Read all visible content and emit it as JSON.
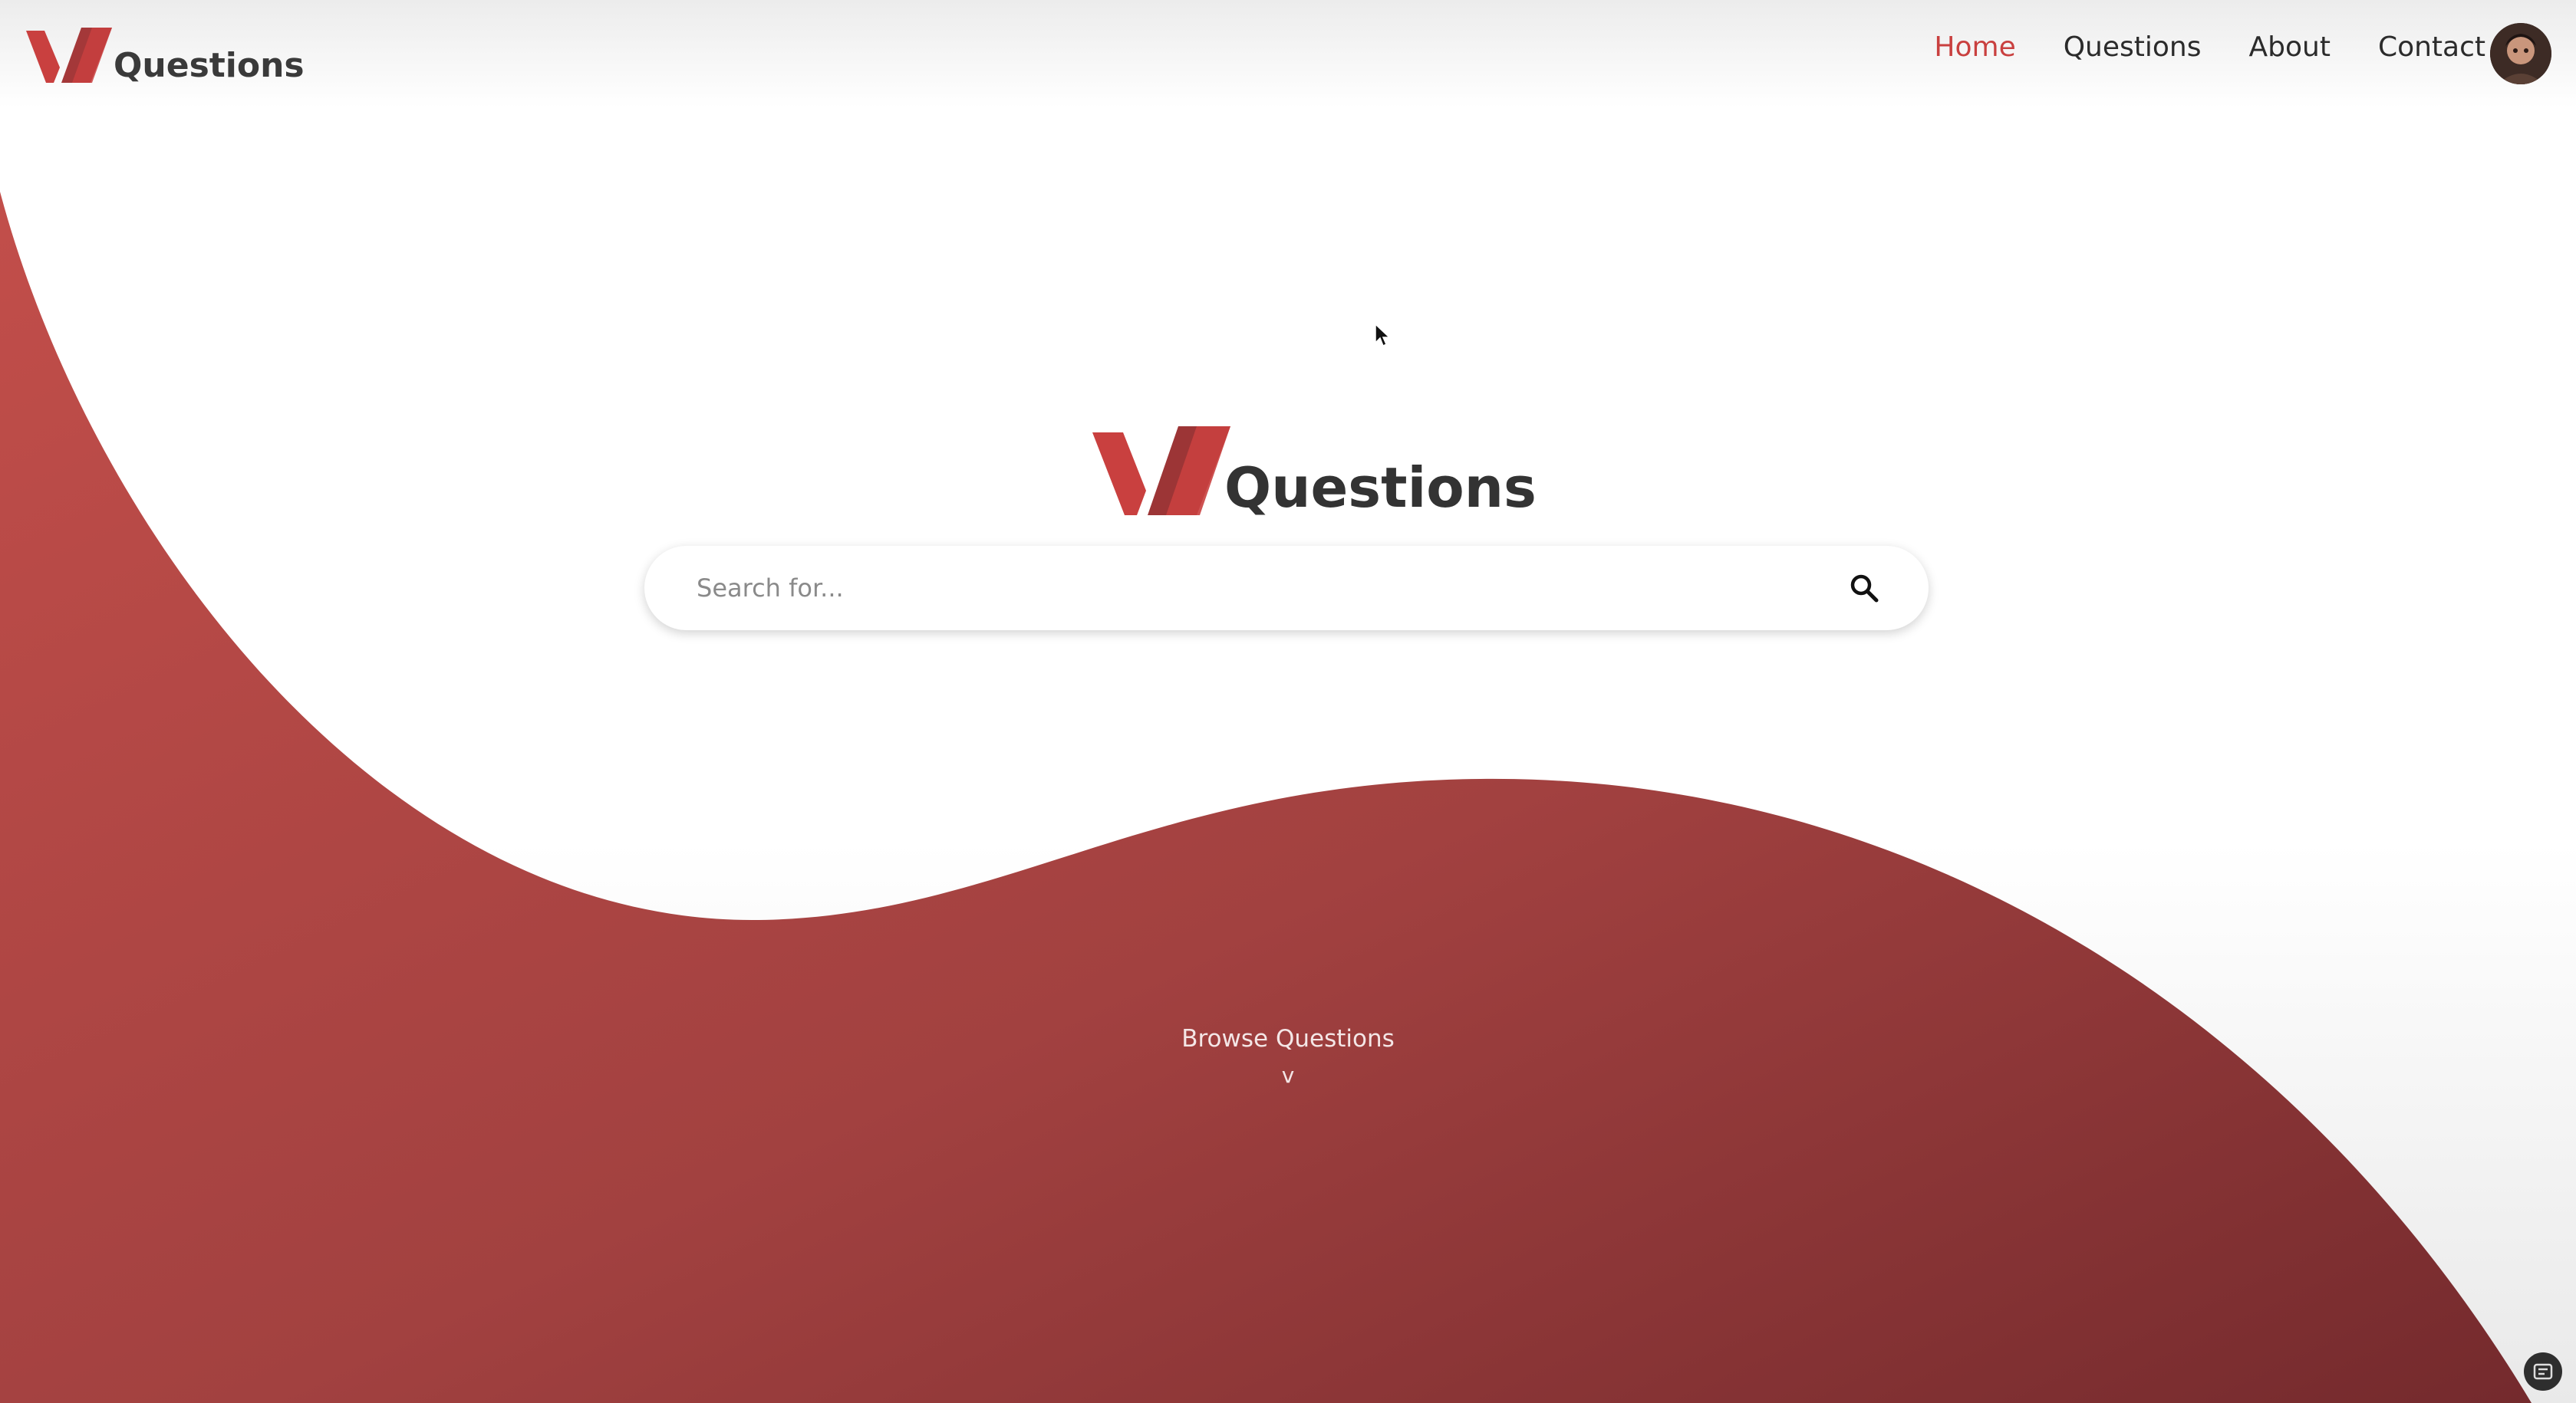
{
  "brand": {
    "name": "Questions",
    "primary_color": "#c9403f",
    "dark_color": "#7a2c2e"
  },
  "header": {
    "logo_text": "Questions",
    "nav": [
      {
        "label": "Home",
        "active": true
      },
      {
        "label": "Questions",
        "active": false
      },
      {
        "label": "About",
        "active": false
      },
      {
        "label": "Contact",
        "active": false
      }
    ],
    "avatar_icon": "user-avatar"
  },
  "hero": {
    "logo_text": "Questions",
    "search": {
      "placeholder": "Search for...",
      "value": "",
      "icon": "search-icon"
    },
    "browse_label": "Browse Questions",
    "browse_chevron": "v"
  }
}
